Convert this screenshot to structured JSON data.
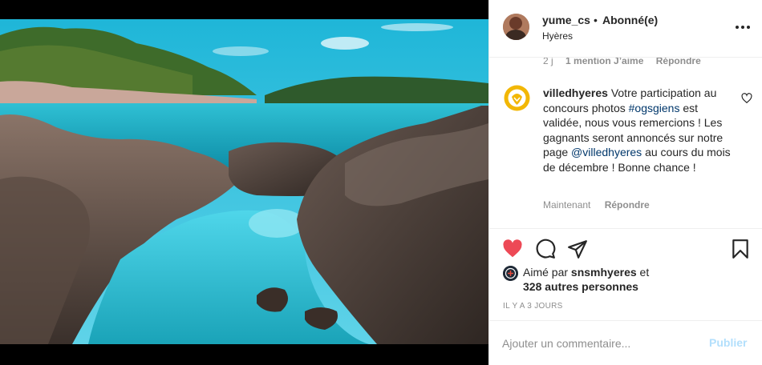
{
  "post": {
    "photo_alt": "Rocky seaside cove with turquoise water"
  },
  "header": {
    "username": "yume_cs",
    "separator": "•",
    "follow_status": "Abonné(e)",
    "location": "Hyères"
  },
  "previous_comment_meta": {
    "time": "2 j",
    "likes": "1 mention J’aime",
    "reply": "Répondre"
  },
  "comment": {
    "username": "villedhyeres",
    "text_part1": " Votre participation au concours photos ",
    "hashtag": "#ogsgiens",
    "text_part2": " est validée, nous vous remercions ! Les gagnants seront annoncés sur notre page ",
    "mention": "@villedhyeres",
    "text_part3": " au cours du mois de décembre ! Bonne chance !",
    "time": "Maintenant",
    "reply": "Répondre"
  },
  "likes": {
    "prefix": "Aimé par ",
    "user": "snsmhyeres",
    "suffix": " et",
    "others": "328 autres personnes"
  },
  "time_ago": "IL Y A 3 JOURS",
  "add_comment": {
    "placeholder": "Ajouter un commentaire...",
    "publish_label": "Publier"
  },
  "colors": {
    "like_red": "#ed4956",
    "link_blue": "#00376b",
    "publish_disabled": "#b2dffc",
    "water": "#3ac7d6",
    "sky": "#22c0dd"
  },
  "icons": [
    "more-icon",
    "heart-icon",
    "comment-icon",
    "share-icon",
    "bookmark-icon",
    "heart-outline-icon"
  ]
}
